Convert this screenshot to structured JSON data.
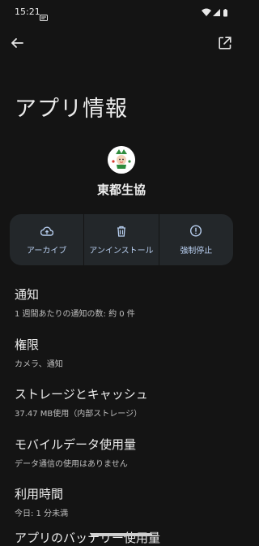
{
  "status_bar": {
    "time": "15:21"
  },
  "header": {
    "title": "アプリ情報"
  },
  "app": {
    "name": "東都生協",
    "brand_colors": {
      "leaf": "#2e8b3d",
      "accent": "#d63a2f"
    }
  },
  "actions": [
    {
      "label": "アーカイブ",
      "icon": "cloud-upload-icon"
    },
    {
      "label": "アンインストール",
      "icon": "trash-icon"
    },
    {
      "label": "強制停止",
      "icon": "alert-circle-icon"
    }
  ],
  "settings": [
    {
      "title": "通知",
      "summary": "1 週間あたりの通知の数: 約 0 件"
    },
    {
      "title": "権限",
      "summary": "カメラ、通知"
    },
    {
      "title": "ストレージとキャッシュ",
      "summary": "37.47 MB使用（内部ストレージ）"
    },
    {
      "title": "モバイルデータ使用量",
      "summary": "データ通信の使用はありません"
    },
    {
      "title": "利用時間",
      "summary": "今日: 1 分未満"
    },
    {
      "title": "アプリのバッテリー使用量"
    }
  ],
  "colors": {
    "background": "#141414",
    "card": "#23272a",
    "accent_text": "#b8cff0"
  }
}
